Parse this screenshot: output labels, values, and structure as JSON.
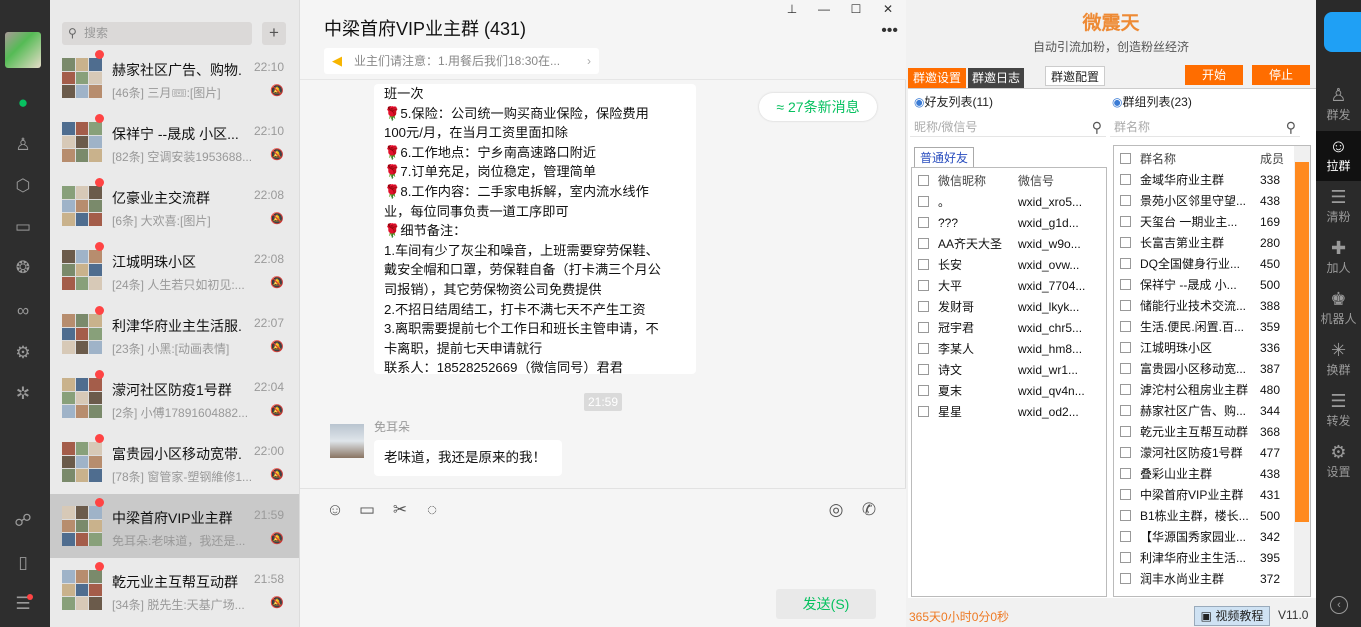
{
  "search": {
    "placeholder": "搜索",
    "add": "+"
  },
  "chats": [
    {
      "name": "赫家社区广告、购物...",
      "time": "22:10",
      "preview": "[46条] 三月🎟:[图片]"
    },
    {
      "name": "保祥宁 --晟成 小区...",
      "time": "22:10",
      "preview": "[82条] 空调安装1953688..."
    },
    {
      "name": "亿豪业主交流群",
      "time": "22:08",
      "preview": "[6条] 大欢喜:[图片]"
    },
    {
      "name": "江城明珠小区",
      "time": "22:08",
      "preview": "[24条] 人生若只如初见:..."
    },
    {
      "name": "利津华府业主生活服...",
      "time": "22:07",
      "preview": "[23条] 小黑:[动画表情]"
    },
    {
      "name": "濛河社区防疫1号群",
      "time": "22:04",
      "preview": "[2条] 小傅17891604882..."
    },
    {
      "name": "富贵园小区移动宽带...",
      "time": "22:00",
      "preview": "[78条] 窗管家-塑钢維修1..."
    },
    {
      "name": "中梁首府VIP业主群",
      "time": "21:59",
      "preview": "免耳朵:老味道，我还是..."
    },
    {
      "name": "乾元业主互帮互动群",
      "time": "21:58",
      "preview": "[34条] 脱先生:天基广场..."
    }
  ],
  "chat": {
    "title": "中梁首府VIP业主群 (431)",
    "notice": "业主们请注意：1.用餐后我们18:30在...",
    "new_messages": "≈ 27条新消息",
    "bubble_lines": [
      "班一次",
      "🌹5.保险：公司统一购买商业保险，保险费用",
      "100元/月，在当月工资里面扣除",
      "🌹6.工作地点：宁乡南高速路口附近",
      "🌹7.订单充足，岗位稳定，管理简单",
      "🌹8.工作内容：二手家电拆解，室内流水线作",
      "业，每位同事负责一道工序即可",
      "🌹细节备注：",
      "1.车间有少了灰尘和噪音，上班需要穿劳保鞋、",
      "戴安全帽和口罩，劳保鞋自备（打卡满三个月公",
      "司报销），其它劳保物资公司免费提供",
      "2.不招日结周结工，打卡不满七天不产生工资",
      "3.离职需要提前七个工作日和班长主管申请，不",
      "卡离职，提前七天申请就行",
      "联系人：18528252669（微信同号）君君"
    ],
    "timestamp": "21:59",
    "sender": "免耳朵",
    "message": "老味道，我还是原来的我！",
    "send_label": "发送(S)"
  },
  "plugin": {
    "brand": "微震天",
    "slogan": "自动引流加粉，创造粉丝经济",
    "tabs": [
      "群邀设置",
      "群邀日志",
      "群邀配置"
    ],
    "start": "开始",
    "stop": "停止",
    "friends_title": "好友列表(11)",
    "friends_search": "昵称/微信号",
    "friends_tab": "普通好友",
    "friends_cols": [
      "微信昵称",
      "微信号"
    ],
    "friends": [
      {
        "nick": "。",
        "id": "wxid_xro5..."
      },
      {
        "nick": "???",
        "id": "wxid_g1d..."
      },
      {
        "nick": "AA齐天大圣",
        "id": "wxid_w9o..."
      },
      {
        "nick": "长安",
        "id": "wxid_ovw..."
      },
      {
        "nick": "大平",
        "id": "wxid_7704..."
      },
      {
        "nick": "发财哥",
        "id": "wxid_lkyk..."
      },
      {
        "nick": "冠宇君",
        "id": "wxid_chr5..."
      },
      {
        "nick": "李某人",
        "id": "wxid_hm8..."
      },
      {
        "nick": "诗文",
        "id": "wxid_wr1..."
      },
      {
        "nick": "夏末",
        "id": "wxid_qv4n..."
      },
      {
        "nick": "星星",
        "id": "wxid_od2..."
      }
    ],
    "groups_title": "群组列表(23)",
    "groups_search": "群名称",
    "groups_cols": [
      "群名称",
      "成员"
    ],
    "groups": [
      {
        "name": "金域华府业主群",
        "n": "338"
      },
      {
        "name": "景苑小区邻里守望...",
        "n": "438"
      },
      {
        "name": "天玺台 一期业主...",
        "n": "169"
      },
      {
        "name": "长富吉第业主群",
        "n": "280"
      },
      {
        "name": "DQ全国健身行业...",
        "n": "450"
      },
      {
        "name": "保祥宁 --晟成 小...",
        "n": "500"
      },
      {
        "name": "储能行业技术交流...",
        "n": "388"
      },
      {
        "name": "生活.便民.闲置.百...",
        "n": "359"
      },
      {
        "name": "江城明珠小区",
        "n": "336"
      },
      {
        "name": "富贵园小区移动宽...",
        "n": "387"
      },
      {
        "name": "滹沱村公租房业主群",
        "n": "480"
      },
      {
        "name": "赫家社区广告、购...",
        "n": "344"
      },
      {
        "name": "乾元业主互帮互动群",
        "n": "368"
      },
      {
        "name": "濛河社区防疫1号群",
        "n": "477"
      },
      {
        "name": "叠彩山业主群",
        "n": "438"
      },
      {
        "name": "中梁首府VIP业主群",
        "n": "431"
      },
      {
        "name": "B1栋业主群，楼长...",
        "n": "500"
      },
      {
        "name": "【华源国秀家园业...",
        "n": "342"
      },
      {
        "name": "利津华府业主生活...",
        "n": "395"
      },
      {
        "name": "润丰水尚业主群",
        "n": "372"
      }
    ],
    "timer": "365天0小时0分0秒",
    "video": "视频教程",
    "version": "V11.0"
  },
  "rightbar": [
    {
      "label": "群发"
    },
    {
      "label": "拉群"
    },
    {
      "label": "清粉"
    },
    {
      "label": "加人"
    },
    {
      "label": "机器人"
    },
    {
      "label": "换群"
    },
    {
      "label": "转发"
    },
    {
      "label": "设置"
    }
  ]
}
